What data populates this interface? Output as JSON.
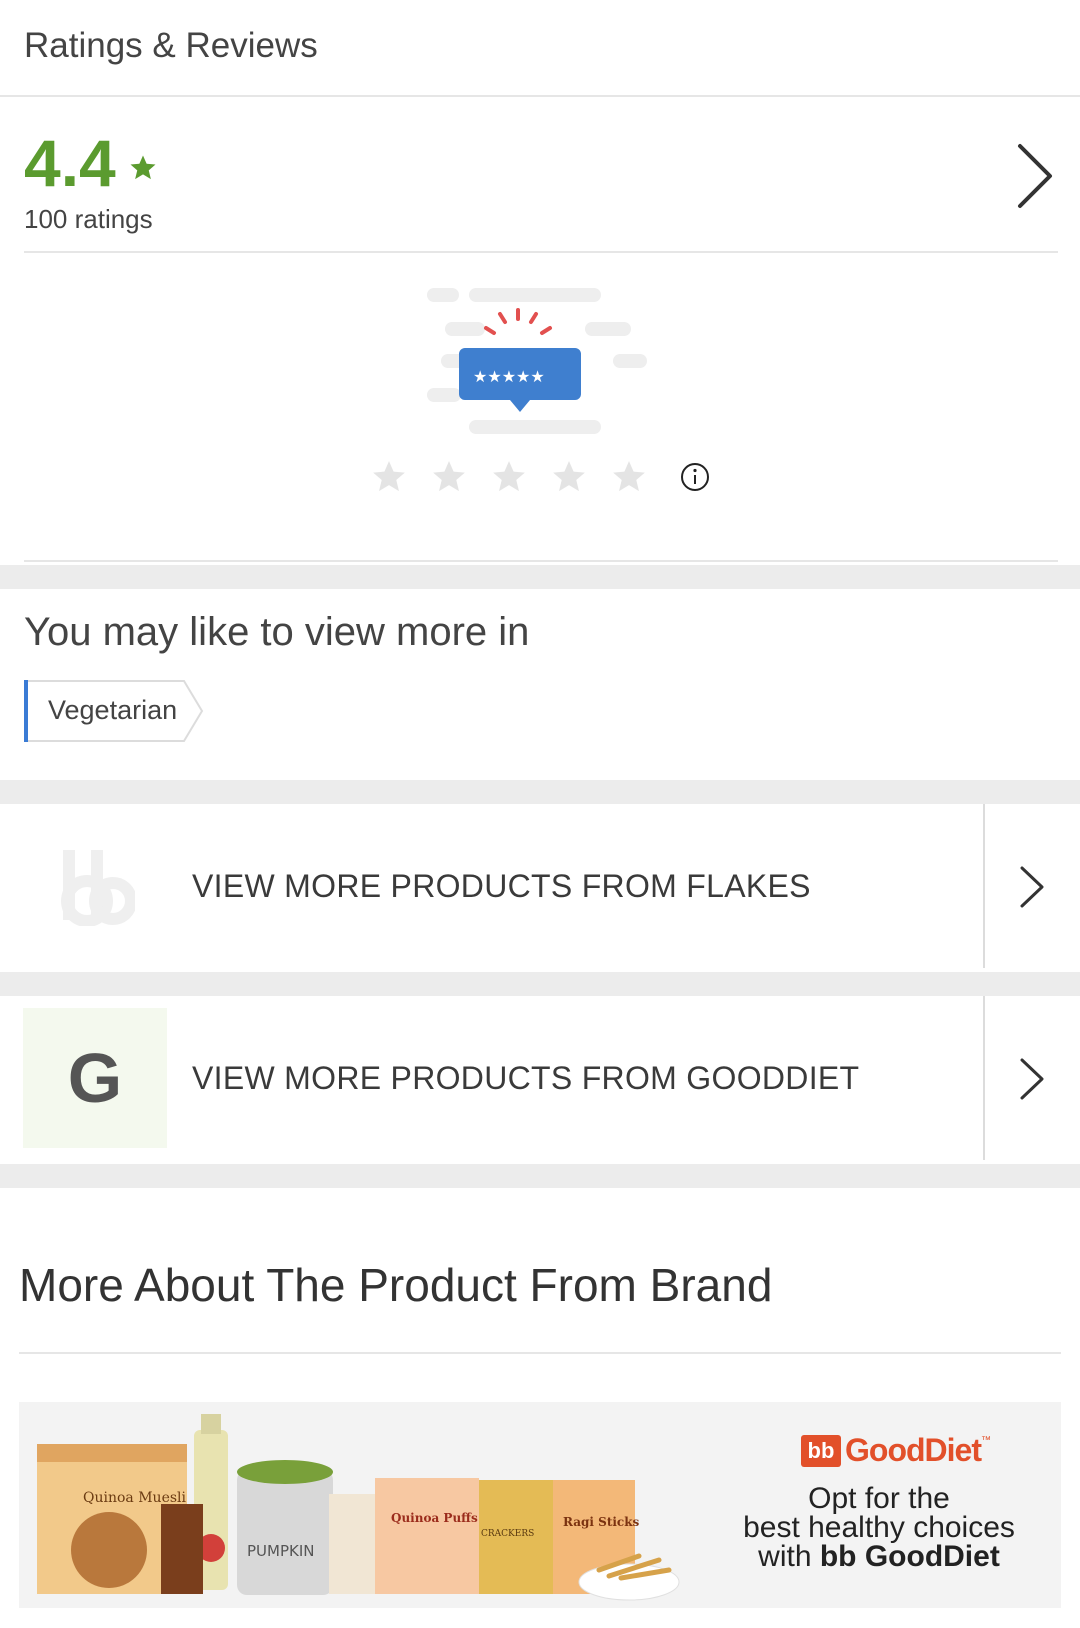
{
  "ratings_section": {
    "title": "Ratings & Reviews",
    "average": "4.4",
    "count_label": "100 ratings",
    "rate_stars_total": 5
  },
  "recommend": {
    "title": "You may like to view more in",
    "tag_label": "Vegetarian"
  },
  "links": [
    {
      "label": "VIEW MORE PRODUCTS FROM FLAKES",
      "thumb": "bb"
    },
    {
      "label": "VIEW MORE PRODUCTS FROM GOODDIET",
      "thumb": "G"
    }
  ],
  "brand_section": {
    "title": "More About The Product From Brand",
    "banner": {
      "logo_mark": "bb",
      "logo_word": "GoodDiet",
      "logo_tm": "™",
      "tagline_line1": "Opt for the",
      "tagline_line2": "best healthy choices",
      "tagline_line3_prefix": "with ",
      "tagline_line3_bold": "bb GoodDiet",
      "product_labels": [
        "Quinoa Muesli",
        "PUMPKIN",
        "Quinoa Puffs",
        "CRACKERS",
        "Ragi Sticks"
      ]
    }
  },
  "colors": {
    "rating_green": "#5b9b2f",
    "brand_orange": "#e2502a",
    "tag_accent": "#3a7bd5",
    "band_gray": "#ececec"
  }
}
